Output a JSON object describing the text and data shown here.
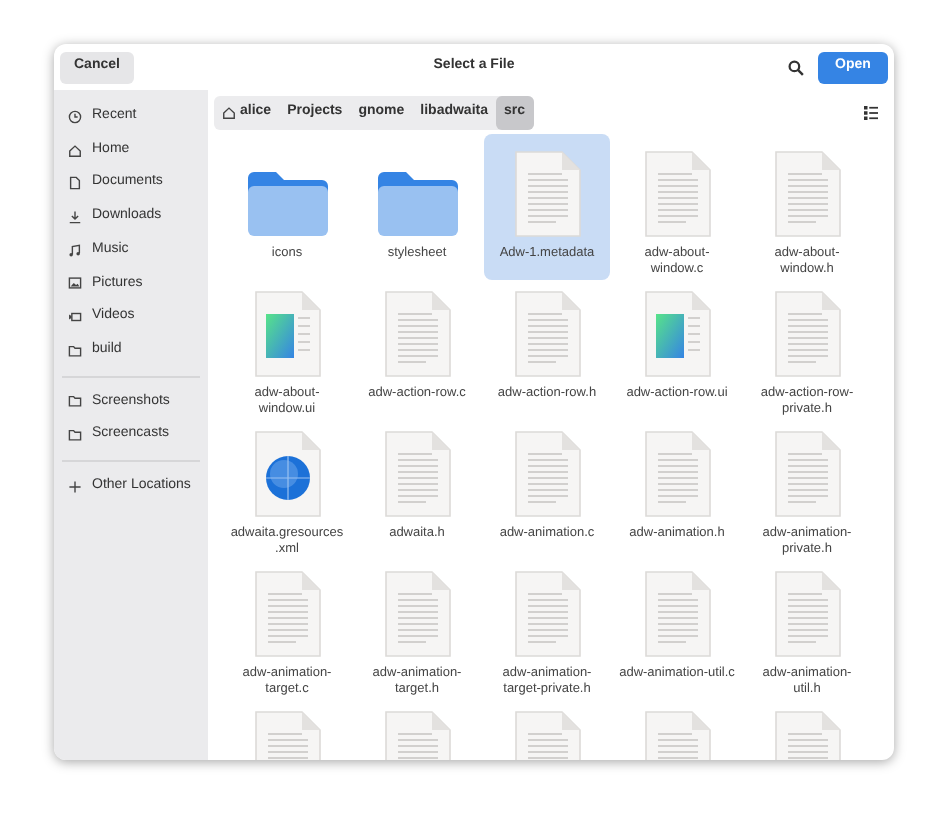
{
  "header": {
    "cancel": "Cancel",
    "title": "Select a File",
    "open": "Open"
  },
  "sidebar": {
    "sections": [
      {
        "items": [
          {
            "label": "Recent"
          },
          {
            "label": "Home"
          },
          {
            "label": "Documents"
          },
          {
            "label": "Downloads"
          },
          {
            "label": "Music"
          },
          {
            "label": "Pictures"
          },
          {
            "label": "Videos"
          },
          {
            "label": "build"
          }
        ]
      },
      {
        "items": [
          {
            "label": "Screenshots"
          },
          {
            "label": "Screencasts"
          }
        ]
      },
      {
        "items": [
          {
            "label": "Other Locations"
          }
        ]
      }
    ]
  },
  "path": [
    {
      "label": "alice",
      "selected": false
    },
    {
      "label": "Projects",
      "selected": false
    },
    {
      "label": "gnome",
      "selected": false
    },
    {
      "label": "libadwaita",
      "selected": false
    },
    {
      "label": "src",
      "selected": true
    }
  ],
  "files": [
    {
      "name": "icons",
      "kind": "folder",
      "selected": false
    },
    {
      "name": "stylesheet",
      "kind": "folder",
      "selected": false
    },
    {
      "name": "Adw-1.metadata",
      "kind": "document",
      "selected": true
    },
    {
      "name": "adw-about-window.c",
      "kind": "document",
      "selected": false
    },
    {
      "name": "adw-about-window.h",
      "kind": "document",
      "selected": false
    },
    {
      "name": "adw-about-window.ui",
      "kind": "ui",
      "selected": false
    },
    {
      "name": "adw-action-row.c",
      "kind": "document",
      "selected": false
    },
    {
      "name": "adw-action-row.h",
      "kind": "document",
      "selected": false
    },
    {
      "name": "adw-action-row.ui",
      "kind": "ui",
      "selected": false
    },
    {
      "name": "adw-action-row-private.h",
      "kind": "document",
      "selected": false
    },
    {
      "name": "adwaita.gresources.xml",
      "kind": "resource",
      "selected": false
    },
    {
      "name": "adwaita.h",
      "kind": "document",
      "selected": false
    },
    {
      "name": "adw-animation.c",
      "kind": "document",
      "selected": false
    },
    {
      "name": "adw-animation.h",
      "kind": "document",
      "selected": false
    },
    {
      "name": "adw-animation-private.h",
      "kind": "document",
      "selected": false
    },
    {
      "name": "adw-animation-target.c",
      "kind": "document",
      "selected": false
    },
    {
      "name": "adw-animation-target.h",
      "kind": "document",
      "selected": false
    },
    {
      "name": "adw-animation-target-private.h",
      "kind": "document",
      "selected": false
    },
    {
      "name": "adw-animation-util.c",
      "kind": "document",
      "selected": false
    },
    {
      "name": "adw-animation-util.h",
      "kind": "document",
      "selected": false
    },
    {
      "kind": "document",
      "selected": false
    },
    {
      "kind": "document",
      "selected": false
    },
    {
      "kind": "document",
      "selected": false
    },
    {
      "kind": "document",
      "selected": false
    },
    {
      "kind": "document",
      "selected": false
    }
  ]
}
